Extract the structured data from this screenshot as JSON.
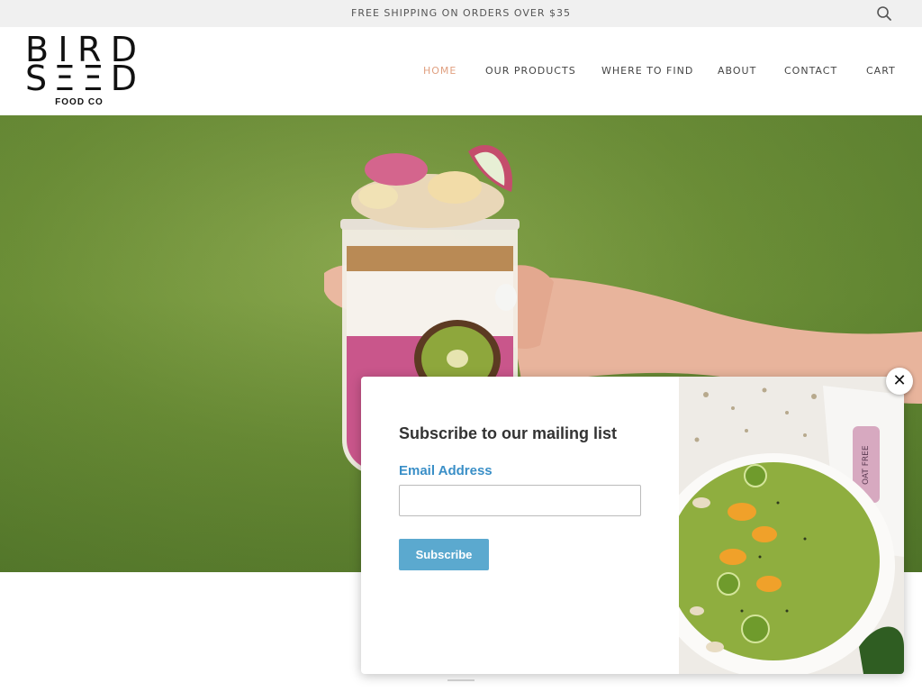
{
  "announcement": "FREE SHIPPING ON ORDERS OVER $35",
  "icons": {
    "search": "search-icon",
    "close": "close-icon"
  },
  "brand": {
    "row1": [
      "B",
      "I",
      "R",
      "D"
    ],
    "row2": [
      "S",
      "Ξ",
      "Ξ",
      "D"
    ],
    "sub": "FOOD CO"
  },
  "nav": [
    {
      "label": "HOME",
      "active": true
    },
    {
      "label": "OUR PRODUCTS",
      "active": false
    },
    {
      "label": "WHERE TO FIND",
      "active": false
    },
    {
      "label": "ABOUT",
      "active": false
    },
    {
      "label": "CONTACT",
      "active": false
    },
    {
      "label": "CART",
      "active": false
    }
  ],
  "popup": {
    "title": "Subscribe to our mailing list",
    "email_label": "Email Address",
    "email_value": "",
    "subscribe_label": "Subscribe",
    "close_glyph": "✕",
    "packet_text": "OAT FREE"
  },
  "colors": {
    "accent_nav_active": "#e0a080",
    "label_blue": "#3a8fc7",
    "button_blue": "#5ba9cf",
    "topbar_bg": "#f0f0f0",
    "hero_green": "#6c8f37"
  }
}
